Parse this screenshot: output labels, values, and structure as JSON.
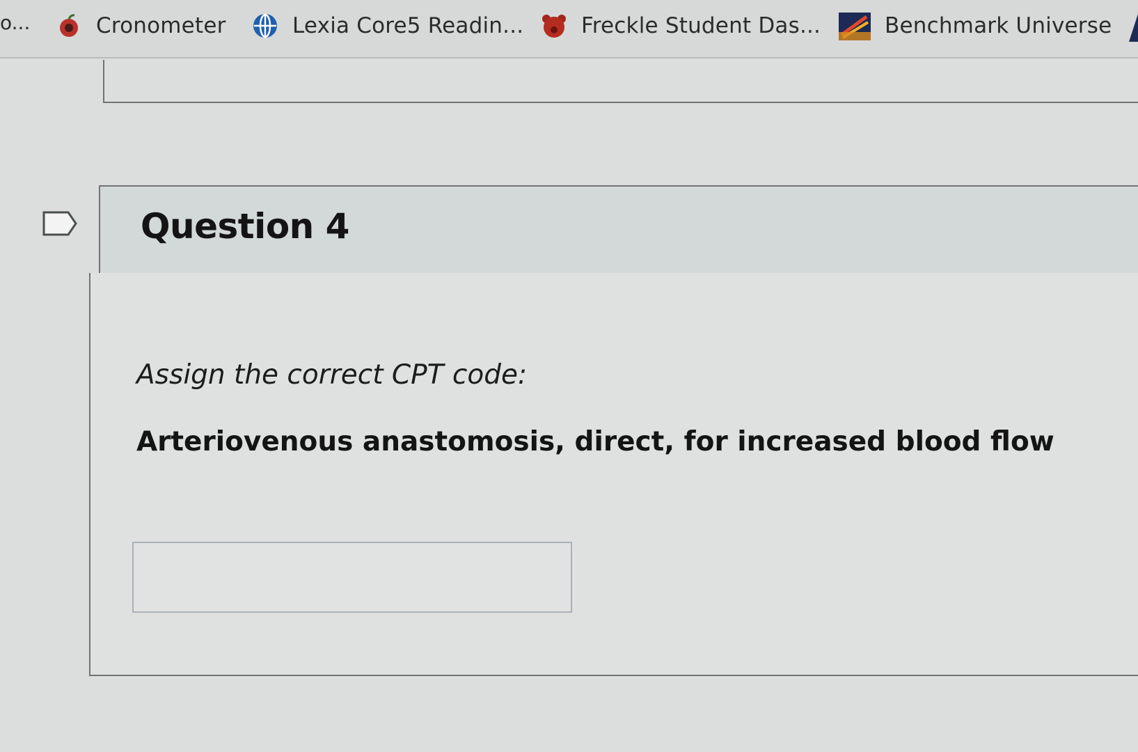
{
  "bookmarks_bar": {
    "leading_overflow": "o...",
    "items": [
      {
        "label": "Cronometer",
        "icon": "apple-icon"
      },
      {
        "label": "Lexia Core5 Readin...",
        "icon": "globe-icon"
      },
      {
        "label": "Freckle Student Das...",
        "icon": "bear-icon"
      },
      {
        "label": "Benchmark Universe",
        "icon": "rocket-icon"
      }
    ]
  },
  "question": {
    "title": "Question 4",
    "prompt": "Assign the correct CPT code:",
    "statement": "Arteriovenous anastomosis, direct, for increased blood flow",
    "answer_value": ""
  }
}
